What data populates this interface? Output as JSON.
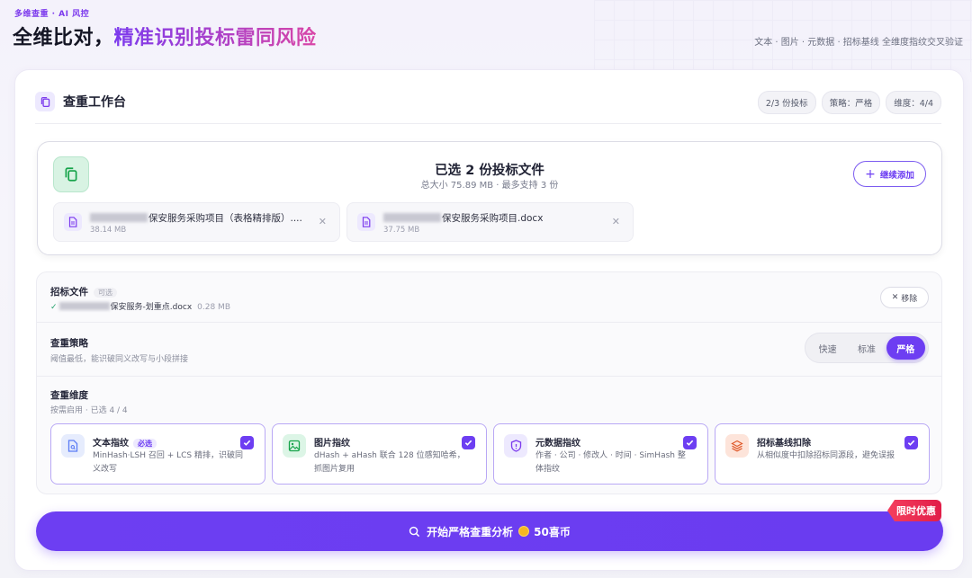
{
  "header": {
    "brand_tag": "多维查重 · AI 风控",
    "title_plain": "全维比对，",
    "title_highlight": "精准识别投标雷同风险",
    "subtitle": "文本 · 图片 · 元数据 · 招标基线 全维度指纹交叉验证"
  },
  "workspace": {
    "title": "查重工作台",
    "chips": [
      "2/3 份投标",
      "策略：严格",
      "维度：4/4"
    ]
  },
  "upload": {
    "title": "已选 2 份投标文件",
    "subtitle": "总大小 75.89 MB · 最多支持 3 份",
    "add_label": "继续添加",
    "files": [
      {
        "name": "保安服务采购项目（表格精排版）....",
        "size": "38.14 MB"
      },
      {
        "name": "保安服务采购项目.docx",
        "size": "37.75 MB"
      }
    ]
  },
  "tender": {
    "label": "招标文件",
    "optional": "可选",
    "file_name": "保安服务-划重点.docx",
    "file_size": "0.28 MB",
    "remove_label": "移除"
  },
  "strategy": {
    "label": "查重策略",
    "desc": "阈值最低，能识破同义改写与小段拼接",
    "options": [
      "快速",
      "标准",
      "严格"
    ],
    "selected": "严格"
  },
  "dimensions": {
    "label": "查重维度",
    "desc": "按需启用 · 已选 4 / 4",
    "items": [
      {
        "title": "文本指纹",
        "badge": "必选",
        "desc": "MinHash·LSH 召回 + LCS 精排，识破同义改写",
        "icon": "text-doc-icon",
        "color": "#5b7cf5",
        "bg": "#e6ecfd",
        "checked": true
      },
      {
        "title": "图片指纹",
        "badge": "",
        "desc": "dHash + aHash 联合 128 位感知哈希，抓图片复用",
        "icon": "image-icon",
        "color": "#16a34a",
        "bg": "#dcf5e6",
        "checked": true
      },
      {
        "title": "元数据指纹",
        "badge": "",
        "desc": "作者 · 公司 · 修改人 · 时间 · SimHash 整体指纹",
        "icon": "shield-icon",
        "color": "#7c3aed",
        "bg": "#ede9fe",
        "checked": true
      },
      {
        "title": "招标基线扣除",
        "badge": "",
        "desc": "从相似度中扣除招标同源段，避免误报",
        "icon": "layers-icon",
        "color": "#e05a2b",
        "bg": "#fde4da",
        "checked": true
      }
    ]
  },
  "action": {
    "start_label": "开始严格查重分析",
    "cost": "50喜币",
    "promo": "限时优惠"
  }
}
